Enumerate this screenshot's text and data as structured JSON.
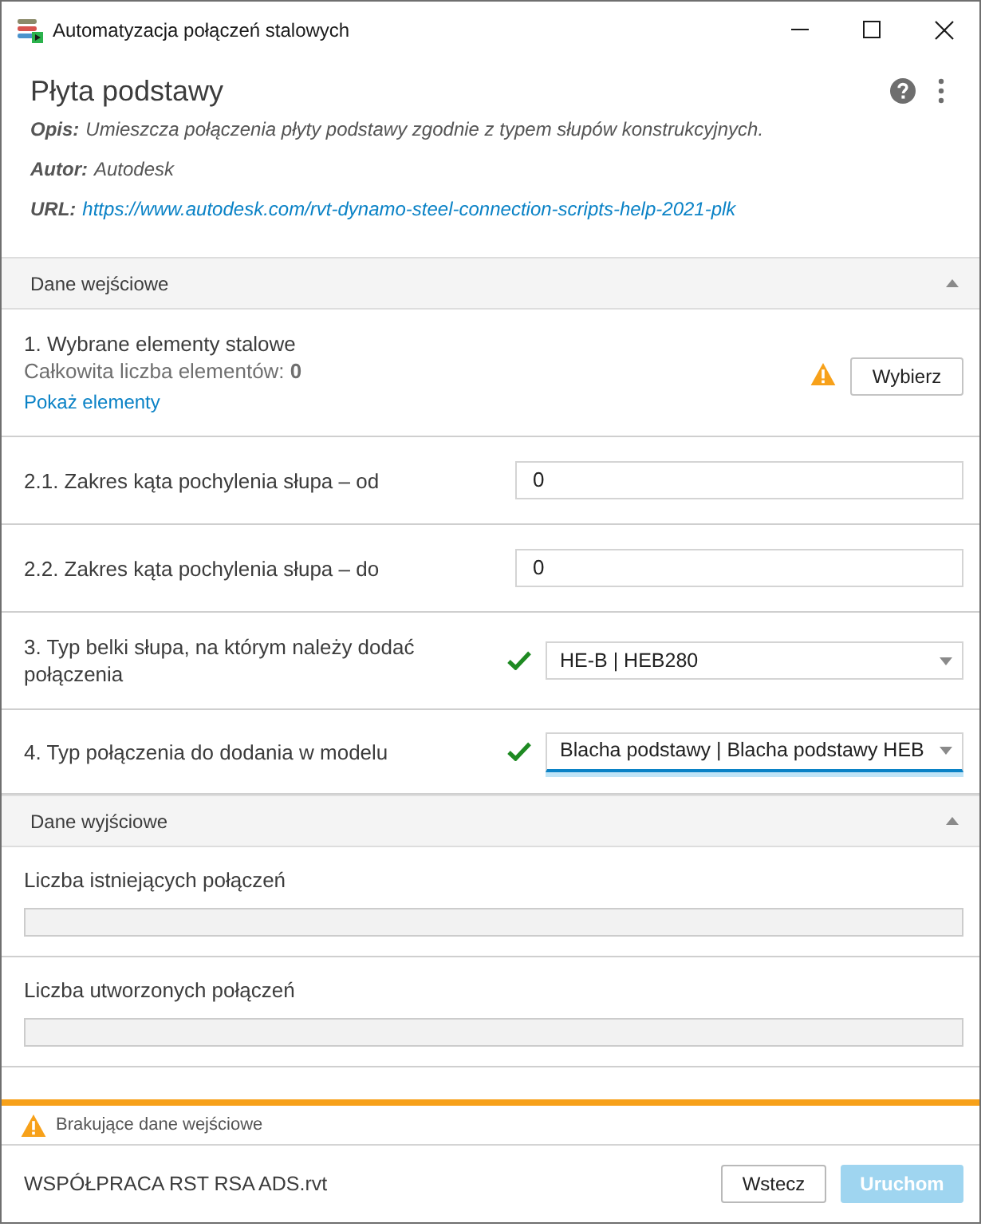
{
  "window": {
    "title": "Automatyzacja połączeń stalowych"
  },
  "header": {
    "title": "Płyta podstawy",
    "details": [
      {
        "kind": "text",
        "label": "Opis:",
        "value": "Umieszcza połączenia płyty podstawy zgodnie z typem słupów konstrukcyjnych."
      },
      {
        "kind": "text",
        "label": "Autor:",
        "value": "Autodesk"
      },
      {
        "kind": "link",
        "label": "URL:",
        "value": "https://www.autodesk.com/rvt-dynamo-steel-connection-scripts-help-2021-plk"
      }
    ]
  },
  "sections": [
    {
      "title": "Dane wejściowe",
      "expanded": true,
      "rows": [
        {
          "kind": "selection",
          "label": "1. Wybrane elementy stalowe",
          "count": "Całkowita liczba elementów: **0**",
          "link": "Pokaż elementy",
          "warning": true,
          "button": "Wybierz"
        },
        {
          "kind": "number",
          "label": "2.1. Zakres kąta pochylenia słupa – od",
          "value": "0"
        },
        {
          "kind": "number",
          "label": "2.2. Zakres kąta pochylenia słupa – do",
          "value": "0"
        },
        {
          "kind": "dropdown",
          "label": "3. Typ belki słupa, na którym należy dodać połączenia",
          "value": "HE-B | HEB280",
          "valid": true,
          "focused": false
        },
        {
          "kind": "dropdown",
          "label": "4. Typ połączenia do dodania w modelu",
          "value": "Blacha podstawy | Blacha podstawy HEB",
          "valid": true,
          "focused": true
        }
      ]
    },
    {
      "title": "Dane wyjściowe",
      "expanded": true,
      "rows": [
        {
          "kind": "output",
          "label": "Liczba istniejących połączeń",
          "disabled": true
        },
        {
          "kind": "output",
          "label": "Liczba utworzonych połączeń",
          "disabled": true
        }
      ]
    }
  ],
  "status": {
    "kind": "warning",
    "message": "Brakujące dane wejściowe"
  },
  "footer": {
    "file": "WSPÓŁPRACA RST RSA ADS.rvt",
    "buttons": [
      {
        "label": "Wstecz",
        "kind": "secondary",
        "disabled": false
      },
      {
        "label": "Uruchom",
        "kind": "primary",
        "disabled": true
      }
    ]
  }
}
